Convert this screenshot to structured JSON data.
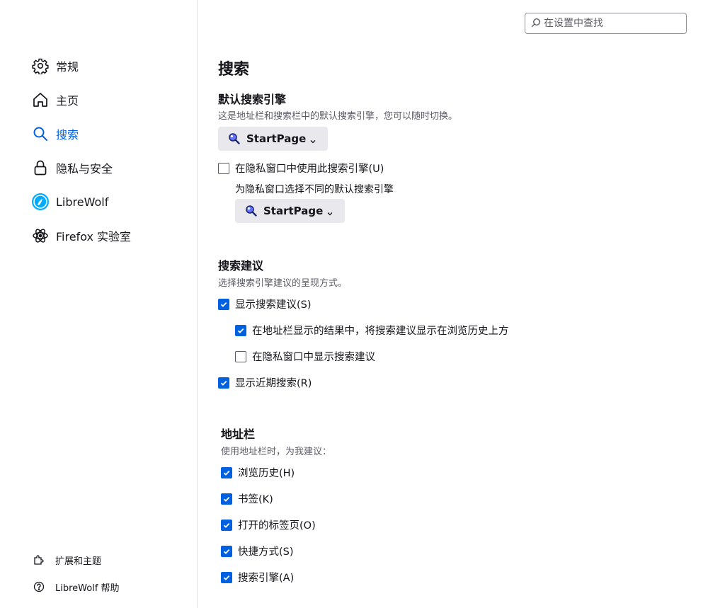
{
  "search_placeholder": "在设置中查找",
  "sidebar": {
    "items": [
      {
        "label": "常规",
        "icon": "gear-icon"
      },
      {
        "label": "主页",
        "icon": "home-icon"
      },
      {
        "label": "搜索",
        "icon": "search-icon"
      },
      {
        "label": "隐私与安全",
        "icon": "lock-icon"
      },
      {
        "label": "LibreWolf",
        "icon": "librewolf-icon"
      },
      {
        "label": "Firefox 实验室",
        "icon": "atom-icon"
      }
    ],
    "selected": "搜索",
    "footer": [
      {
        "label": "扩展和主题",
        "icon": "puzzle-icon"
      },
      {
        "label": "LibreWolf 帮助",
        "icon": "help-icon"
      }
    ]
  },
  "main": {
    "title": "搜索",
    "default_engine": {
      "heading": "默认搜索引擎",
      "desc": "这是地址栏和搜索栏中的默认搜索引擎，您可以随时切换。",
      "engine": "StartPage",
      "private_checkbox": "在隐私窗口中使用此搜索引擎(U)",
      "private_checkbox_checked": false,
      "private_desc": "为隐私窗口选择不同的默认搜索引擎",
      "private_engine": "StartPage"
    },
    "suggestions": {
      "heading": "搜索建议",
      "desc": "选择搜索引擎建议的呈现方式。",
      "show": {
        "label": "显示搜索建议(S)",
        "checked": true
      },
      "above_history": {
        "label": "在地址栏显示的结果中，将搜索建议显示在浏览历史上方",
        "checked": true
      },
      "private": {
        "label": "在隐私窗口中显示搜索建议",
        "checked": false
      },
      "recent": {
        "label": "显示近期搜索(R)",
        "checked": true
      }
    },
    "address_bar": {
      "heading": "地址栏",
      "desc": "使用地址栏时，为我建议：",
      "items": [
        {
          "label": "浏览历史(H)",
          "checked": true
        },
        {
          "label": "书签(K)",
          "checked": true
        },
        {
          "label": "打开的标签页(O)",
          "checked": true
        },
        {
          "label": "快捷方式(S)",
          "checked": true
        },
        {
          "label": "搜索引擎(A)",
          "checked": true
        }
      ]
    }
  },
  "colors": {
    "accent": "#0061e0",
    "button_bg": "#e9e9ed"
  }
}
